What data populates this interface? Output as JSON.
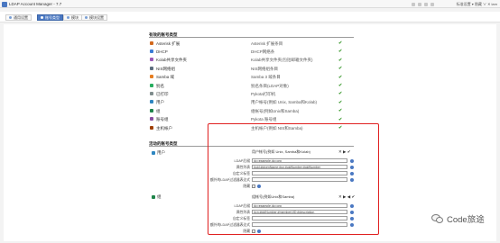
{
  "window": {
    "title": "LDAP Account Manager - 7.7",
    "top_right_text": "标准设置 ▾ 隐藏 ∨ ✕ lam"
  },
  "tabs": [
    {
      "label": "通用设置",
      "active": false
    },
    {
      "label": "账号类型",
      "active": true
    },
    {
      "label": "模块",
      "active": false
    },
    {
      "label": "模块设置",
      "active": false
    }
  ],
  "available_section": {
    "title": "有效的账号类型",
    "items": [
      {
        "name": "Asterisk 扩展",
        "desc": "Asterisk 扩展条目",
        "icon_color": "#d2691e"
      },
      {
        "name": "DHCP",
        "desc": "DHCP网络条",
        "icon_color": "#3a7bd5"
      },
      {
        "name": "Kolab共享文件夹",
        "desc": "Kolab共享文件夹(包括邮箱文件夹)",
        "icon_color": "#9b59b6"
      },
      {
        "name": "NIS网络组",
        "desc": "NIS网络组条目",
        "icon_color": "#5d6d7e"
      },
      {
        "name": "Samba 域",
        "desc": "Samba 3 域条目",
        "icon_color": "#e67e22"
      },
      {
        "name": "别名",
        "desc": "别名条目(LDAP对象)",
        "icon_color": "#27ae60"
      },
      {
        "name": "已打印",
        "desc": "Pykota打印机",
        "icon_color": "#7f8c8d"
      },
      {
        "name": "用户",
        "desc": "用户帐号(例如 Unix, Samba和Kolab)",
        "icon_color": "#2e86c1"
      },
      {
        "name": "组",
        "desc": "组帐号(例如Unix和Samba)",
        "icon_color": "#1e8449"
      },
      {
        "name": "账号组",
        "desc": "Pykota 账号组",
        "icon_color": "#884ea0"
      },
      {
        "name": "主机帐户",
        "desc": "主机帐户(例如 NIS和Samba)",
        "icon_color": "#a04000"
      }
    ]
  },
  "active_section": {
    "title": "活动的账号类型",
    "users": {
      "label": "用户",
      "type_desc": "用户帐号(例如 Unix, Samba和Kolab)",
      "head_icons": "✕ ▶ ✔",
      "fields": {
        "ldap_suffix_label": "LDAP后缀",
        "ldap_suffix_value": "dc=example,dc=org",
        "attributes_label": "属性列表",
        "attributes_value": "#uid;#givenName;#sn;#uidNumber;#gidNumber",
        "custom_label_label": "自定义标签",
        "filter_label": "额外的LDAP过滤器表达式",
        "hidden_label": "隐藏"
      }
    },
    "groups": {
      "label": "组",
      "type_desc": "组帐号(例如Unix和Samba)",
      "head_icons": "✕ ▶ ◀ ✔",
      "fields": {
        "ldap_suffix_label": "LDAP后缀",
        "ldap_suffix_value": "dc=example,dc=org",
        "attributes_label": "属性列表",
        "attributes_value": "#cn;#gidNumber;#memberUID;#description",
        "custom_label_label": "自定义标签",
        "filter_label": "额外的LDAP过滤器表达式",
        "hidden_label": "隐藏"
      }
    }
  },
  "watermark": {
    "text": "Code旅途"
  },
  "colors": {
    "accent": "#4a78c2",
    "highlight_border": "#e02020",
    "check_green": "#3c9a2f"
  }
}
